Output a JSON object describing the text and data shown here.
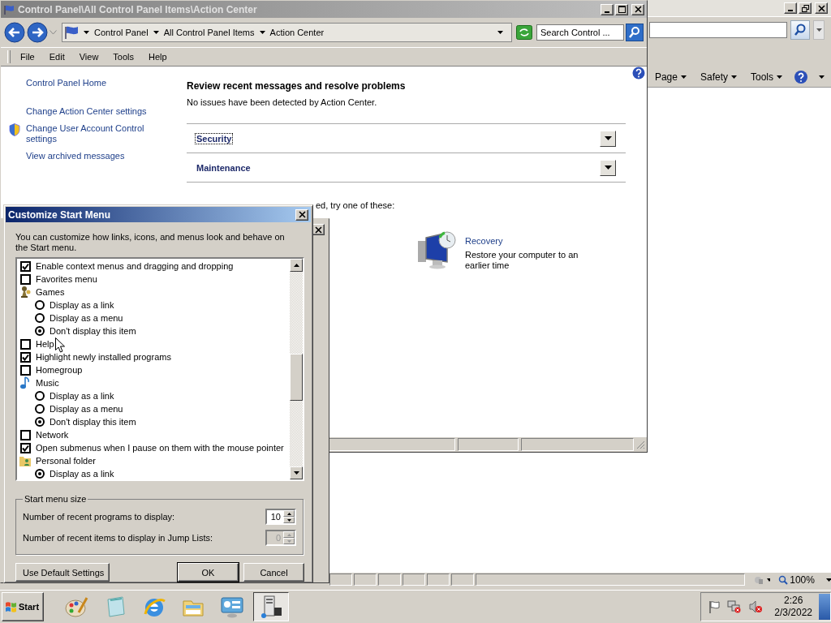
{
  "ie_window": {
    "command_bar": [
      "Page",
      "Safety",
      "Tools"
    ],
    "status_bar": {
      "zoom": "100%"
    }
  },
  "control_panel": {
    "title": "Control Panel\\All Control Panel Items\\Action Center",
    "breadcrumb": [
      "Control Panel",
      "All Control Panel Items",
      "Action Center"
    ],
    "search": {
      "placeholder": "Search Control ..."
    },
    "menu": [
      "File",
      "Edit",
      "View",
      "Tools",
      "Help"
    ],
    "sidebar": {
      "items": [
        {
          "kind": "link",
          "label": "Control Panel Home"
        },
        {
          "kind": "link",
          "label": "Change Action Center settings"
        },
        {
          "kind": "shield-link",
          "label": "Change User Account Control settings"
        },
        {
          "kind": "link",
          "label": "View archived messages"
        }
      ]
    },
    "heading": "Review recent messages and resolve problems",
    "message": "No issues have been detected by Action Center.",
    "sections": [
      {
        "label": "Security",
        "focused": true
      },
      {
        "label": "Maintenance",
        "focused": false
      }
    ],
    "hint": "ed, try one of these:",
    "recovery": {
      "title": "Recovery",
      "description": "Restore your computer to an earlier time"
    }
  },
  "dialog": {
    "title": "Customize Start Menu",
    "intro": "You can customize how links, icons, and menus look and behave on the Start menu.",
    "options": [
      {
        "kind": "checkbox",
        "label": "Enable context menus and dragging and dropping",
        "checked": true
      },
      {
        "kind": "checkbox",
        "label": "Favorites menu",
        "checked": false
      },
      {
        "kind": "group",
        "label": "Games",
        "children": [
          {
            "label": "Display as a link",
            "selected": false
          },
          {
            "label": "Display as a menu",
            "selected": false
          },
          {
            "label": "Don't display this item",
            "selected": true
          }
        ]
      },
      {
        "kind": "checkbox",
        "label": "Help",
        "checked": false
      },
      {
        "kind": "checkbox",
        "label": "Highlight newly installed programs",
        "checked": true
      },
      {
        "kind": "checkbox",
        "label": "Homegroup",
        "checked": false
      },
      {
        "kind": "group",
        "label": "Music",
        "children": [
          {
            "label": "Display as a link",
            "selected": false
          },
          {
            "label": "Display as a menu",
            "selected": false
          },
          {
            "label": "Don't display this item",
            "selected": true
          }
        ]
      },
      {
        "kind": "checkbox",
        "label": "Network",
        "checked": false
      },
      {
        "kind": "checkbox",
        "label": "Open submenus when I pause on them with the mouse pointer",
        "checked": true
      },
      {
        "kind": "group",
        "label": "Personal folder",
        "children": [
          {
            "label": "Display as a link",
            "selected": true
          }
        ]
      }
    ],
    "size_group": {
      "legend": "Start menu size",
      "rows": [
        {
          "label": "Number of recent programs to display:",
          "value": "10",
          "disabled": false
        },
        {
          "label": "Number of recent items to display in Jump Lists:",
          "value": "0",
          "disabled": true
        }
      ]
    },
    "buttons": [
      {
        "label": "Use Default Settings",
        "default": false
      },
      {
        "label": "OK",
        "default": true
      },
      {
        "label": "Cancel",
        "default": false
      }
    ]
  },
  "taskbar": {
    "start": "Start",
    "apps": [
      {
        "selected": false
      },
      {
        "selected": false
      },
      {
        "selected": false
      },
      {
        "selected": false
      },
      {
        "selected": false
      },
      {
        "selected": true
      }
    ],
    "time": "2:26",
    "date": "2/3/2022"
  }
}
